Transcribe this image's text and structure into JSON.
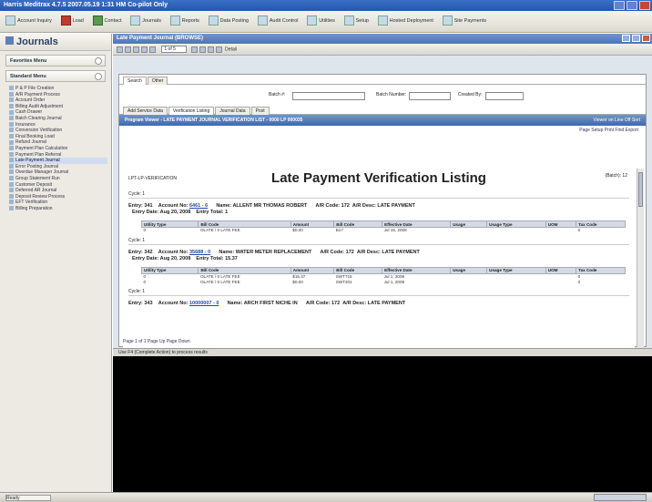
{
  "window": {
    "title": "Harris Meditrax 4.7.5 2007.05.19 1:31 HM Co-pilot Only"
  },
  "toolbar": {
    "items": [
      "Account Inquiry",
      "Load",
      "Contact",
      "Journals",
      "Reports",
      "Data Posting",
      "Audit Control",
      "Utilities",
      "Setup",
      "Hosted Deployment",
      "Site Payments"
    ]
  },
  "left": {
    "header": "Journals",
    "section1": "Favorites Menu",
    "section2": "Standard Menu",
    "tree": [
      "P & P File Creation",
      "A/R Payment Process",
      "Account Order",
      "Billing Audit Adjustment",
      "Cash Drawer",
      "Batch Clearing Journal",
      "Insurance",
      "Conversion Verification",
      "Final Booking Load",
      "Refund Journal",
      "Payment Plan Calculation",
      "Payment Plan Referral",
      "Late Payment Journal",
      "Error Posting Journal",
      "Overdue Manager Journal",
      "Group Statement Run",
      "Customer Deposit",
      "Deferred AR Journal",
      "Deposit Review Process",
      "EFT Verification",
      "Billing Preparation"
    ]
  },
  "main": {
    "window_title": "Late Payment Journal (BROWSE)",
    "page_of": "1 of 5",
    "view": "Detail",
    "tabs_top": [
      "Search",
      "Other"
    ],
    "search": {
      "batch_label": "Batch #:",
      "batch_number_label": "Batch Number:",
      "created_by_label": "Created By:"
    },
    "report_tabs": [
      "Add Service Data",
      "Verification Listing",
      "Journal Data",
      "Post"
    ],
    "report_bar": "Program Viewer - LATE PAYMENT JOURNAL VERIFICATION LIST - 0000 LP 000035",
    "report_bar_right": "Viewer on  Line Off  Sort",
    "report_tools": "Page Setup  Print  Find  Export",
    "report": {
      "left_code": "LPT-LP-VERIFICATION",
      "title": "Late Payment Verification Listing",
      "batch": "(Batch): 12",
      "cycles": [
        {
          "cycle": "Cycle: 1",
          "entry": "Entry: 341",
          "account_label": "Account No:",
          "account": "6461 - 6",
          "name": "Name: ALLENT MR THOMAS ROBERT",
          "ab_code": "A/R Code: 172",
          "ab_desc": "A/R Desc: LATE PAYMENT",
          "entry_date": "Entry Date: Aug 20, 2008",
          "entry_total": "Entry Total: 1",
          "cols": [
            "Utility Type",
            "Bill Code",
            "Amount",
            "Bill Code",
            "Effective Date",
            "Usage",
            "Usage Type",
            "UOM",
            "Tax Code"
          ],
          "rows": [
            [
              "0",
              "OLATE / 0 LATE FEE",
              "$0.00",
              "B17",
              "Jul 15, 2008",
              "",
              "",
              "",
              "0"
            ]
          ]
        },
        {
          "cycle": "Cycle: 1",
          "entry": "Entry: 342",
          "account_label": "Account No:",
          "account": "35688 - 0",
          "name": "Name: WATER METER REPLACEMENT",
          "ab_code": "A/R Code: 172",
          "ab_desc": "A/R Desc: LATE PAYMENT",
          "entry_date": "Entry Date: Aug 20, 2008",
          "entry_total": "Entry Total: 15.37",
          "cols": [
            "Utility Type",
            "Bill Code",
            "Amount",
            "Bill Code",
            "Effective Date",
            "Usage",
            "Usage Type",
            "UOM",
            "Tax Code"
          ],
          "rows": [
            [
              "0",
              "OLATE / 0 LATE FEE",
              "$15.37",
              "SWT715",
              "Jul 1, 2008",
              "",
              "",
              "",
              "0"
            ],
            [
              "0",
              "OLATE / 0 LATE FEE",
              "$0.00",
              "SWT201",
              "Jul 1, 2008",
              "",
              "",
              "",
              "0"
            ]
          ]
        },
        {
          "cycle": "Cycle: 1",
          "entry": "Entry: 343",
          "account_label": "Account No:",
          "account": "10000007 - 0",
          "name": "Name: ARCH FIRST NICHE IN",
          "ab_code": "A/R Code: 172",
          "ab_desc": "A/R Desc: LATE PAYMENT",
          "entry_date": "",
          "entry_total": "",
          "cols": [],
          "rows": []
        }
      ],
      "pager": "Page 1 of 1 Page Up Page Down"
    },
    "status": "Use F4 (Complete Action) to process results",
    "bottom_status": "Ready"
  },
  "colors": {
    "accent": "#4d76b8",
    "titlebar": "#2456b0"
  }
}
